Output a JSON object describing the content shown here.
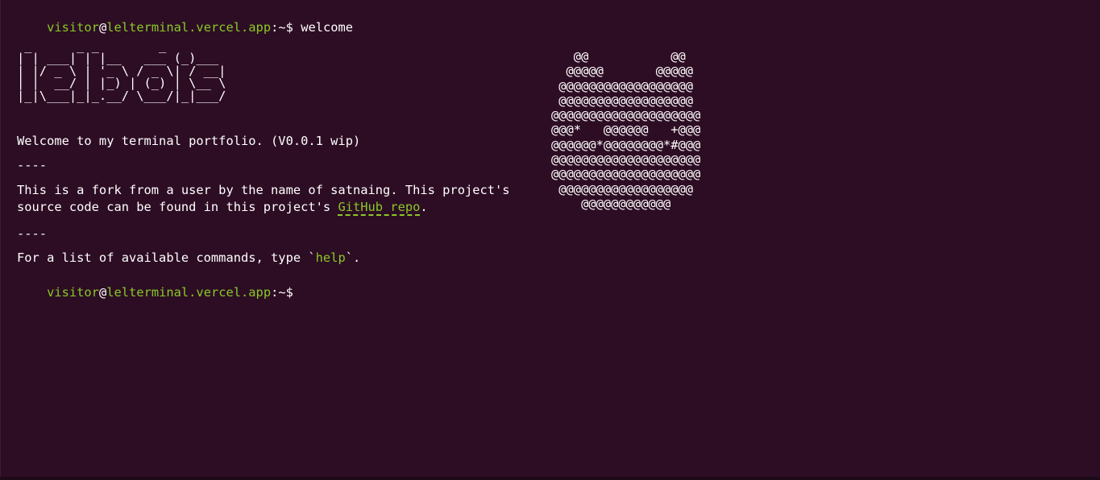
{
  "prompt": {
    "user": "visitor",
    "at": "@",
    "host": "lelterminal.vercel.app",
    "path": ":~$"
  },
  "history": {
    "command": "welcome"
  },
  "logo_ascii": " _      _ _        _\n| | ___| | |__   ___ (_)___\n| |/ _ \\ | '_ \\ / _ \\| / __|\n| |  __/ | |_) | (_) | \\__ \\\n|_|\\___|_|_.__/ \\___/|_|___/",
  "face_ascii": "   @@           @@\n  @@@@@       @@@@@\n @@@@@@@@@@@@@@@@@@\n @@@@@@@@@@@@@@@@@@\n@@@@@@@@@@@@@@@@@@@@\n@@@*   @@@@@@   +@@@\n@@@@@@*@@@@@@@@*#@@@\n@@@@@@@@@@@@@@@@@@@@\n@@@@@@@@@@@@@@@@@@@@\n @@@@@@@@@@@@@@@@@@\n    @@@@@@@@@@@@",
  "welcome": {
    "intro": "Welcome to my terminal portfolio. (V0.0.1 wip)",
    "divider": "----",
    "fork_line1": "This is a fork from a user by the name of satnaing. This project's",
    "fork_line2_prefix": "source code can be found in this project's ",
    "repo_link": "GitHub repo",
    "fork_line2_suffix": ".",
    "help_prefix": "For a list of available commands, type `",
    "help_cmd": "help",
    "help_suffix": "`."
  },
  "colors": {
    "background": "#2d0d24",
    "accent": "#8ac926",
    "text": "#ffffff"
  }
}
